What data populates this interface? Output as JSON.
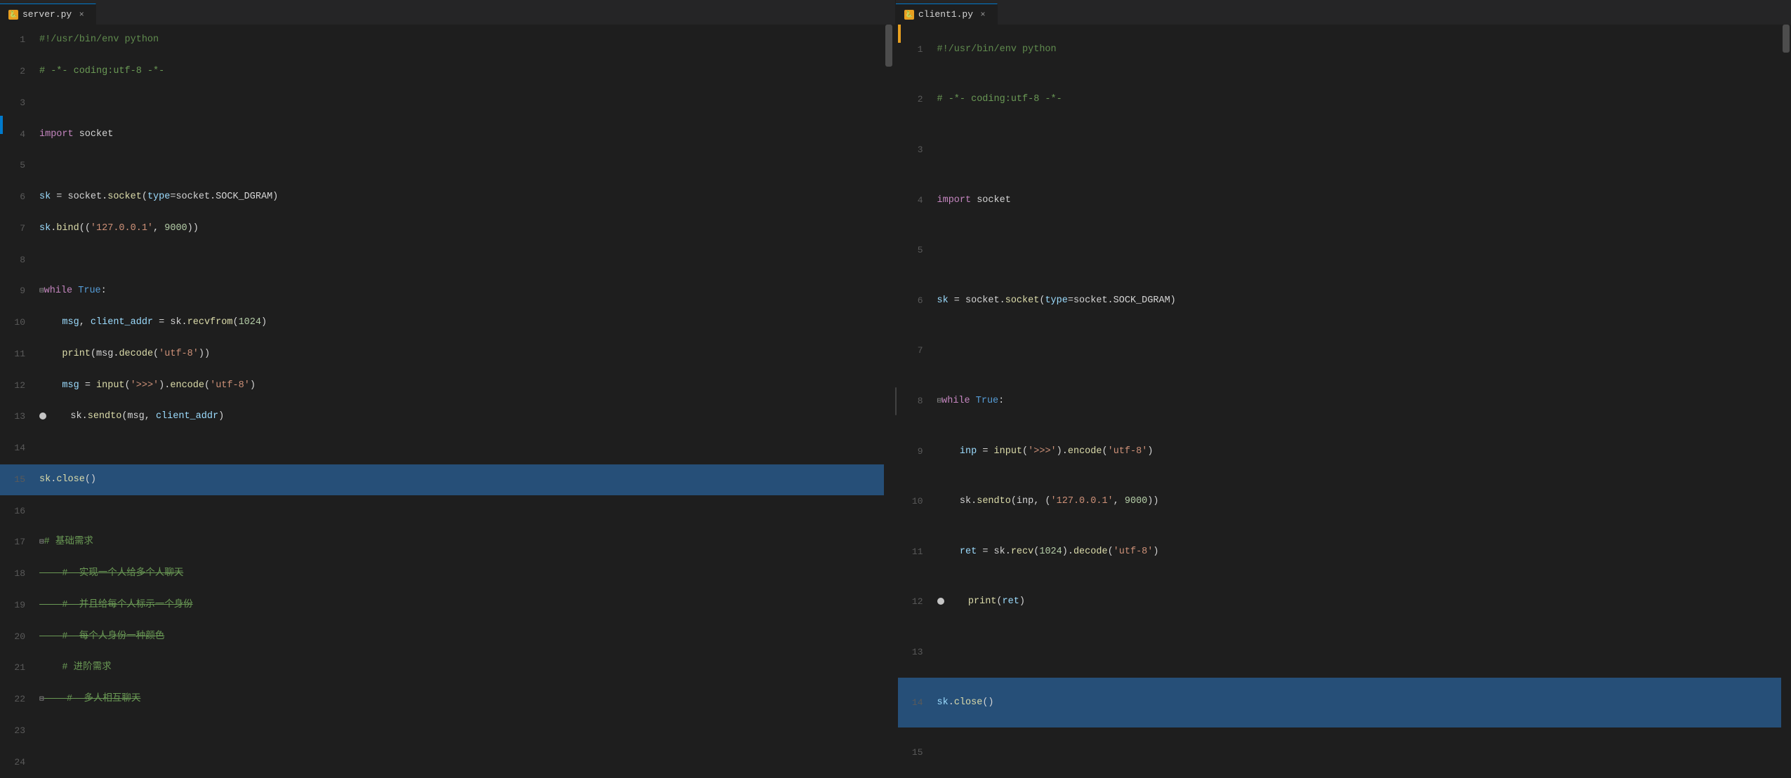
{
  "tabs": [
    {
      "id": "server",
      "filename": "server.py",
      "active": true,
      "modified": false
    },
    {
      "id": "client1",
      "filename": "client1.py",
      "active": true,
      "modified": false
    }
  ],
  "server_lines": [
    {
      "n": 1,
      "tokens": [
        {
          "t": "shebang",
          "v": "#!/usr/bin/env python"
        }
      ]
    },
    {
      "n": 2,
      "tokens": [
        {
          "t": "cmt-plain",
          "v": "# -*- coding:utf-8 -*-"
        }
      ]
    },
    {
      "n": 3,
      "tokens": []
    },
    {
      "n": 4,
      "tokens": [
        {
          "t": "kw",
          "v": "import"
        },
        {
          "t": "plain",
          "v": " socket"
        }
      ]
    },
    {
      "n": 5,
      "tokens": []
    },
    {
      "n": 6,
      "tokens": [
        {
          "t": "var",
          "v": "sk"
        },
        {
          "t": "plain",
          "v": " = socket."
        },
        {
          "t": "fn",
          "v": "socket"
        },
        {
          "t": "plain",
          "v": "("
        },
        {
          "t": "param",
          "v": "type"
        },
        {
          "t": "plain",
          "v": "=socket.SOCK_DGRAM)"
        }
      ]
    },
    {
      "n": 7,
      "tokens": [
        {
          "t": "var",
          "v": "sk"
        },
        {
          "t": "plain",
          "v": "."
        },
        {
          "t": "fn",
          "v": "bind"
        },
        {
          "t": "plain",
          "v": "(("
        },
        {
          "t": "str",
          "v": "'127.0.0.1'"
        },
        {
          "t": "plain",
          "v": ", "
        },
        {
          "t": "num",
          "v": "9000"
        },
        {
          "t": "plain",
          "v": "))"
        }
      ]
    },
    {
      "n": 8,
      "tokens": []
    },
    {
      "n": 9,
      "tokens": [
        {
          "t": "fold",
          "v": ""
        },
        {
          "t": "kw",
          "v": "while"
        },
        {
          "t": "plain",
          "v": " "
        },
        {
          "t": "kw2",
          "v": "True"
        },
        {
          "t": "plain",
          "v": ":"
        }
      ]
    },
    {
      "n": 10,
      "tokens": [
        {
          "t": "plain",
          "v": "    "
        },
        {
          "t": "var",
          "v": "msg"
        },
        {
          "t": "plain",
          "v": ", "
        },
        {
          "t": "var",
          "v": "client_addr"
        },
        {
          "t": "plain",
          "v": " = sk."
        },
        {
          "t": "fn",
          "v": "recvfrom"
        },
        {
          "t": "plain",
          "v": "("
        },
        {
          "t": "num",
          "v": "1024"
        },
        {
          "t": "plain",
          "v": ")"
        }
      ]
    },
    {
      "n": 11,
      "tokens": [
        {
          "t": "plain",
          "v": "    "
        },
        {
          "t": "fn",
          "v": "print"
        },
        {
          "t": "plain",
          "v": "(msg."
        },
        {
          "t": "fn",
          "v": "decode"
        },
        {
          "t": "plain",
          "v": "("
        },
        {
          "t": "str",
          "v": "'utf-8'"
        },
        {
          "t": "plain",
          "v": "))"
        }
      ]
    },
    {
      "n": 12,
      "tokens": [
        {
          "t": "plain",
          "v": "    "
        },
        {
          "t": "var",
          "v": "msg"
        },
        {
          "t": "plain",
          "v": " = "
        },
        {
          "t": "fn",
          "v": "input"
        },
        {
          "t": "plain",
          "v": "("
        },
        {
          "t": "str",
          "v": "'>>>'"
        },
        {
          "t": "plain",
          "v": ")."
        },
        {
          "t": "fn",
          "v": "encode"
        },
        {
          "t": "plain",
          "v": "("
        },
        {
          "t": "str",
          "v": "'utf-8'"
        },
        {
          "t": "plain",
          "v": ")"
        }
      ]
    },
    {
      "n": 13,
      "tokens": [
        {
          "t": "bp",
          "v": ""
        },
        {
          "t": "plain",
          "v": "    sk."
        },
        {
          "t": "fn",
          "v": "sendto"
        },
        {
          "t": "plain",
          "v": "(msg, "
        },
        {
          "t": "var",
          "v": "client_addr"
        },
        {
          "t": "plain",
          "v": ")"
        }
      ]
    },
    {
      "n": 14,
      "tokens": []
    },
    {
      "n": 15,
      "tokens": [
        {
          "t": "highlighted_line",
          "v": true
        },
        {
          "t": "fn",
          "v": "sk"
        },
        {
          "t": "plain",
          "v": "."
        },
        {
          "t": "fn",
          "v": "close"
        },
        {
          "t": "plain",
          "v": "()"
        }
      ]
    },
    {
      "n": 16,
      "tokens": []
    },
    {
      "n": 17,
      "tokens": [
        {
          "t": "fold",
          "v": ""
        },
        {
          "t": "cmt-plain",
          "v": "# 基础需求"
        }
      ]
    },
    {
      "n": 18,
      "tokens": [
        {
          "t": "cmt",
          "v": "    #  实现一个人给多个人聊天"
        }
      ]
    },
    {
      "n": 19,
      "tokens": [
        {
          "t": "cmt",
          "v": "    #  并且给每个人标示一个身份"
        }
      ]
    },
    {
      "n": 20,
      "tokens": [
        {
          "t": "cmt",
          "v": "    #  每个人身份一种颜色"
        }
      ]
    },
    {
      "n": 21,
      "tokens": [
        {
          "t": "cmt-plain",
          "v": "    # 进阶需求"
        }
      ]
    },
    {
      "n": 22,
      "tokens": [
        {
          "t": "fold",
          "v": ""
        },
        {
          "t": "cmt",
          "v": "    #  多人相互聊天"
        }
      ]
    },
    {
      "n": 23,
      "tokens": []
    },
    {
      "n": 24,
      "tokens": []
    }
  ],
  "client_lines": [
    {
      "n": 1,
      "tokens": [
        {
          "t": "shebang",
          "v": "#!/usr/bin/env python"
        }
      ]
    },
    {
      "n": 2,
      "tokens": [
        {
          "t": "cmt-plain",
          "v": "# -*- coding:utf-8 -*-"
        }
      ]
    },
    {
      "n": 3,
      "tokens": []
    },
    {
      "n": 4,
      "tokens": [
        {
          "t": "kw",
          "v": "import"
        },
        {
          "t": "plain",
          "v": " socket"
        }
      ]
    },
    {
      "n": 5,
      "tokens": []
    },
    {
      "n": 6,
      "tokens": [
        {
          "t": "var",
          "v": "sk"
        },
        {
          "t": "plain",
          "v": " = socket."
        },
        {
          "t": "fn",
          "v": "socket"
        },
        {
          "t": "plain",
          "v": "("
        },
        {
          "t": "param",
          "v": "type"
        },
        {
          "t": "plain",
          "v": "=socket.SOCK_DGRAM)"
        }
      ]
    },
    {
      "n": 7,
      "tokens": []
    },
    {
      "n": 8,
      "tokens": [
        {
          "t": "fold",
          "v": ""
        },
        {
          "t": "kw",
          "v": "while"
        },
        {
          "t": "plain",
          "v": " "
        },
        {
          "t": "kw2",
          "v": "True"
        },
        {
          "t": "plain",
          "v": ":"
        }
      ]
    },
    {
      "n": 9,
      "tokens": [
        {
          "t": "plain",
          "v": "    "
        },
        {
          "t": "var",
          "v": "inp"
        },
        {
          "t": "plain",
          "v": " = "
        },
        {
          "t": "fn",
          "v": "input"
        },
        {
          "t": "plain",
          "v": "("
        },
        {
          "t": "str",
          "v": "'>>>'"
        },
        {
          "t": "plain",
          "v": ")."
        },
        {
          "t": "fn",
          "v": "encode"
        },
        {
          "t": "plain",
          "v": "("
        },
        {
          "t": "str",
          "v": "'utf-8'"
        },
        {
          "t": "plain",
          "v": ")"
        }
      ]
    },
    {
      "n": 10,
      "tokens": [
        {
          "t": "plain",
          "v": "    sk."
        },
        {
          "t": "fn",
          "v": "sendto"
        },
        {
          "t": "plain",
          "v": "(inp, ("
        },
        {
          "t": "str",
          "v": "'127.0.0.1'"
        },
        {
          "t": "plain",
          "v": ", "
        },
        {
          "t": "num",
          "v": "9000"
        },
        {
          "t": "plain",
          "v": "))"
        }
      ]
    },
    {
      "n": 11,
      "tokens": [
        {
          "t": "plain",
          "v": "    "
        },
        {
          "t": "var",
          "v": "ret"
        },
        {
          "t": "plain",
          "v": " = sk."
        },
        {
          "t": "fn",
          "v": "recv"
        },
        {
          "t": "plain",
          "v": "("
        },
        {
          "t": "num",
          "v": "1024"
        },
        {
          "t": "plain",
          "v": ")."
        },
        {
          "t": "fn",
          "v": "decode"
        },
        {
          "t": "plain",
          "v": "("
        },
        {
          "t": "str",
          "v": "'utf-8'"
        },
        {
          "t": "plain",
          "v": ")"
        }
      ]
    },
    {
      "n": 12,
      "tokens": [
        {
          "t": "bp",
          "v": ""
        },
        {
          "t": "plain",
          "v": "    "
        },
        {
          "t": "fn",
          "v": "print"
        },
        {
          "t": "plain",
          "v": "("
        },
        {
          "t": "var",
          "v": "ret"
        },
        {
          "t": "plain",
          "v": ")"
        }
      ]
    },
    {
      "n": 13,
      "tokens": []
    },
    {
      "n": 14,
      "tokens": [
        {
          "t": "highlighted_line",
          "v": true
        },
        {
          "t": "var",
          "v": "sk"
        },
        {
          "t": "plain",
          "v": "."
        },
        {
          "t": "fn",
          "v": "close"
        },
        {
          "t": "plain",
          "v": "()"
        }
      ]
    },
    {
      "n": 15,
      "tokens": []
    }
  ],
  "colors": {
    "bg": "#1e1e1e",
    "tab_active_bg": "#1e1e1e",
    "tab_inactive_bg": "#2d2d2d",
    "tab_border": "#007acc",
    "line_num": "#5a5a5a",
    "keyword_purple": "#c586c0",
    "keyword_blue": "#569cd6",
    "function_yellow": "#dcdcaa",
    "string_orange": "#ce9178",
    "number_green": "#b5cea8",
    "comment_green": "#6a9955",
    "variable_blue": "#9cdcfe",
    "shebang": "#608b4e",
    "plain": "#d4d4d4",
    "highlight_bg": "#3a3a3a",
    "highlight_word_bg": "#264f78"
  }
}
